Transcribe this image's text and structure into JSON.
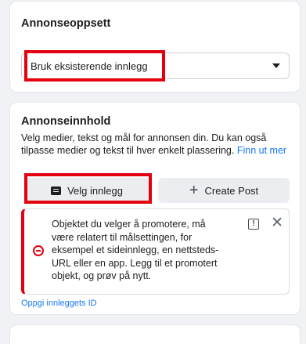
{
  "setup": {
    "title": "Annonseoppsett",
    "select_value": "Bruk eksisterende innlegg"
  },
  "content": {
    "title": "Annonseinnhold",
    "description": "Velg medier, tekst og mål for annonsen din. Du kan også tilpasse medier og tekst til hver enkelt plassering.",
    "learn_more": "Finn ut mer",
    "select_post_label": "Velg innlegg",
    "create_post_label": "Create Post",
    "alert_text": "Objektet du velger å promotere, må være relatert til målsettingen, for eksempel et sideinnlegg, en nettsteds-URL eller en app. Legg til et promotert objekt, og prøv på nytt.",
    "enter_post_id": "Oppgi innleggets ID"
  },
  "icons": {
    "report": "!",
    "close": "✕",
    "plus": "+"
  },
  "colors": {
    "highlight": "#e4000f",
    "link": "#1877f2",
    "error": "#e4000f"
  }
}
